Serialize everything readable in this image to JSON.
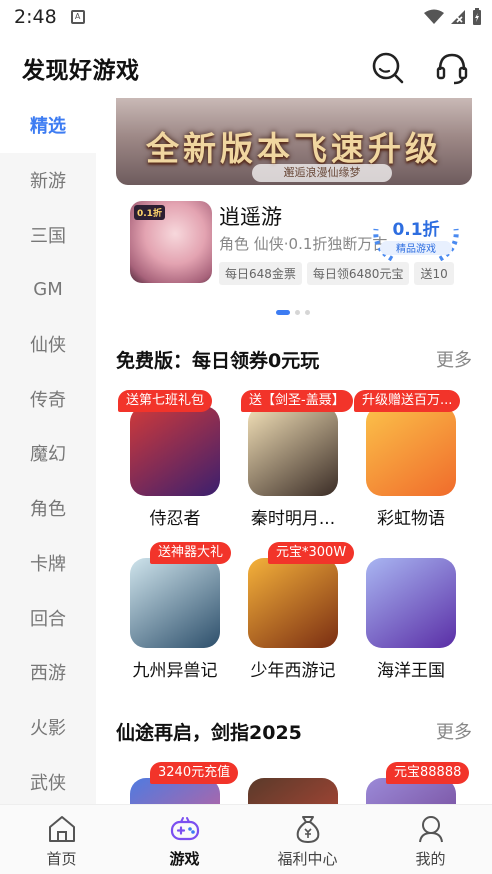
{
  "status_bar": {
    "time": "2:48"
  },
  "header": {
    "title": "发现好游戏"
  },
  "sidebar": {
    "items": [
      {
        "label": "精选",
        "active": true
      },
      {
        "label": "新游"
      },
      {
        "label": "三国"
      },
      {
        "label": "GM"
      },
      {
        "label": "仙侠"
      },
      {
        "label": "传奇"
      },
      {
        "label": "魔幻"
      },
      {
        "label": "角色"
      },
      {
        "label": "卡牌"
      },
      {
        "label": "回合"
      },
      {
        "label": "西游"
      },
      {
        "label": "火影"
      },
      {
        "label": "武侠"
      }
    ]
  },
  "banner": {
    "title": "全新版本飞速升级",
    "subtitle": "邂逅浪漫仙缘梦"
  },
  "feature": {
    "name": "逍遥游",
    "desc": "角色 仙侠·0.1折独断万古",
    "thumb_tag": "0.1折",
    "badge_main": "0.1折",
    "badge_sub": "精品游戏",
    "chips": [
      "每日648金票",
      "每日领6480元宝",
      "送10"
    ]
  },
  "section1": {
    "title": "免费版：每日领券0元玩",
    "more": "更多",
    "games": [
      {
        "name": "侍忍者",
        "ribbon": "送第七班礼包",
        "colors": [
          "#d03a3a",
          "#3b1f6e"
        ]
      },
      {
        "name": "秦时明月...",
        "ribbon": "送【剑圣-盖聂】",
        "colors": [
          "#f3e1b8",
          "#3a2c26"
        ]
      },
      {
        "name": "彩虹物语",
        "ribbon": "升级赠送百万...",
        "colors": [
          "#fbc14a",
          "#f06b2b"
        ]
      },
      {
        "name": "九州异兽记",
        "ribbon": "送神器大礼",
        "colors": [
          "#cfe4ec",
          "#2d4f6b"
        ]
      },
      {
        "name": "少年西游记",
        "ribbon": "元宝*300W",
        "colors": [
          "#f5b23b",
          "#7a2d12"
        ]
      },
      {
        "name": "海洋王国",
        "ribbon": "",
        "colors": [
          "#a9b6f2",
          "#5a2ea6"
        ]
      }
    ]
  },
  "section2": {
    "title": "仙途再启，剑指2025",
    "more": "更多",
    "games": [
      {
        "ribbon": "3240元充值",
        "colors": [
          "#4f7be0",
          "#e25a8a"
        ]
      },
      {
        "ribbon": "",
        "colors": [
          "#5a3a2a",
          "#c84a3a"
        ]
      },
      {
        "ribbon": "元宝88888",
        "colors": [
          "#9b8ad8",
          "#6b3a8a"
        ]
      }
    ]
  },
  "tabbar": {
    "tabs": [
      {
        "label": "首页"
      },
      {
        "label": "游戏",
        "active": true
      },
      {
        "label": "福利中心"
      },
      {
        "label": "我的"
      }
    ]
  },
  "colors": {
    "accent": "#3d7cf2",
    "ribbon": "#f2342a"
  }
}
